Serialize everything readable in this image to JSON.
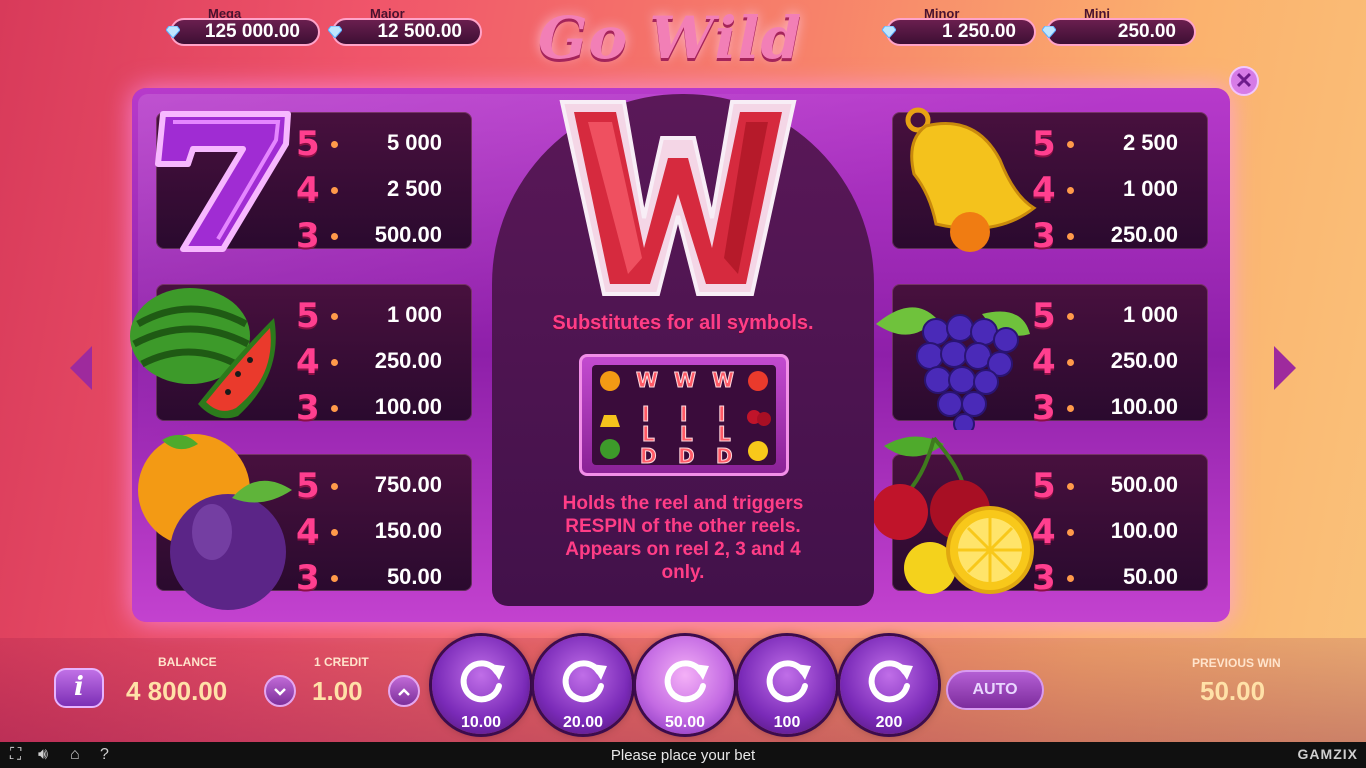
{
  "jackpots": {
    "mega": {
      "label": "Mega",
      "value": "125 000.00"
    },
    "major": {
      "label": "Major",
      "value": "12 500.00"
    },
    "minor": {
      "label": "Minor",
      "value": "1 250.00"
    },
    "mini": {
      "label": "Mini",
      "value": "250.00"
    }
  },
  "logo": "Go Wild",
  "close_icon": "close-icon",
  "paytable": {
    "seven": {
      "icon": "seven-icon",
      "rows": [
        {
          "n": "5",
          "v": "5 000"
        },
        {
          "n": "4",
          "v": "2 500"
        },
        {
          "n": "3",
          "v": "500.00"
        }
      ]
    },
    "melon": {
      "icon": "watermelon-icon",
      "rows": [
        {
          "n": "5",
          "v": "1 000"
        },
        {
          "n": "4",
          "v": "250.00"
        },
        {
          "n": "3",
          "v": "100.00"
        }
      ]
    },
    "plum": {
      "icon": "orange-plum-icon",
      "rows": [
        {
          "n": "5",
          "v": "750.00"
        },
        {
          "n": "4",
          "v": "150.00"
        },
        {
          "n": "3",
          "v": "50.00"
        }
      ]
    },
    "bell": {
      "icon": "bell-icon",
      "rows": [
        {
          "n": "5",
          "v": "2 500"
        },
        {
          "n": "4",
          "v": "1 000"
        },
        {
          "n": "3",
          "v": "250.00"
        }
      ]
    },
    "grapes": {
      "icon": "grapes-icon",
      "rows": [
        {
          "n": "5",
          "v": "1 000"
        },
        {
          "n": "4",
          "v": "250.00"
        },
        {
          "n": "3",
          "v": "100.00"
        }
      ]
    },
    "cherry": {
      "icon": "cherry-lemon-icon",
      "rows": [
        {
          "n": "5",
          "v": "500.00"
        },
        {
          "n": "4",
          "v": "100.00"
        },
        {
          "n": "3",
          "v": "50.00"
        }
      ]
    }
  },
  "wild": {
    "symbol": "W",
    "substitutes": "Substitutes for all symbols.",
    "desc": [
      "Holds the reel and triggers",
      "RESPIN of the other reels.",
      "Appears on reel 2, 3 and 4",
      "only."
    ]
  },
  "controls": {
    "balance_label": "BALANCE",
    "balance": "4 800.00",
    "credit_label": "1 CREDIT",
    "credit": "1.00",
    "bets": [
      "10.00",
      "20.00",
      "50.00",
      "100",
      "200"
    ],
    "selected_bet_index": 2,
    "auto": "AUTO",
    "prev_win_label": "PREVIOUS WIN",
    "prev_win": "50.00"
  },
  "status": {
    "message": "Please place your bet",
    "brand": "GAMZIX"
  },
  "colors": {
    "accent": "#ff3d86",
    "panel": "#a22cbd",
    "card": "#3a0c36"
  }
}
